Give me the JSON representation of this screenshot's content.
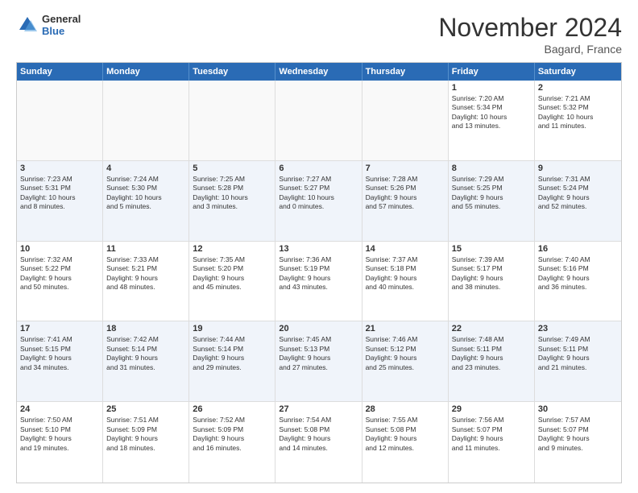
{
  "header": {
    "logo_general": "General",
    "logo_blue": "Blue",
    "month_title": "November 2024",
    "location": "Bagard, France"
  },
  "weekdays": [
    "Sunday",
    "Monday",
    "Tuesday",
    "Wednesday",
    "Thursday",
    "Friday",
    "Saturday"
  ],
  "weeks": [
    [
      {
        "day": "",
        "text": ""
      },
      {
        "day": "",
        "text": ""
      },
      {
        "day": "",
        "text": ""
      },
      {
        "day": "",
        "text": ""
      },
      {
        "day": "",
        "text": ""
      },
      {
        "day": "1",
        "text": "Sunrise: 7:20 AM\nSunset: 5:34 PM\nDaylight: 10 hours\nand 13 minutes."
      },
      {
        "day": "2",
        "text": "Sunrise: 7:21 AM\nSunset: 5:32 PM\nDaylight: 10 hours\nand 11 minutes."
      }
    ],
    [
      {
        "day": "3",
        "text": "Sunrise: 7:23 AM\nSunset: 5:31 PM\nDaylight: 10 hours\nand 8 minutes."
      },
      {
        "day": "4",
        "text": "Sunrise: 7:24 AM\nSunset: 5:30 PM\nDaylight: 10 hours\nand 5 minutes."
      },
      {
        "day": "5",
        "text": "Sunrise: 7:25 AM\nSunset: 5:28 PM\nDaylight: 10 hours\nand 3 minutes."
      },
      {
        "day": "6",
        "text": "Sunrise: 7:27 AM\nSunset: 5:27 PM\nDaylight: 10 hours\nand 0 minutes."
      },
      {
        "day": "7",
        "text": "Sunrise: 7:28 AM\nSunset: 5:26 PM\nDaylight: 9 hours\nand 57 minutes."
      },
      {
        "day": "8",
        "text": "Sunrise: 7:29 AM\nSunset: 5:25 PM\nDaylight: 9 hours\nand 55 minutes."
      },
      {
        "day": "9",
        "text": "Sunrise: 7:31 AM\nSunset: 5:24 PM\nDaylight: 9 hours\nand 52 minutes."
      }
    ],
    [
      {
        "day": "10",
        "text": "Sunrise: 7:32 AM\nSunset: 5:22 PM\nDaylight: 9 hours\nand 50 minutes."
      },
      {
        "day": "11",
        "text": "Sunrise: 7:33 AM\nSunset: 5:21 PM\nDaylight: 9 hours\nand 48 minutes."
      },
      {
        "day": "12",
        "text": "Sunrise: 7:35 AM\nSunset: 5:20 PM\nDaylight: 9 hours\nand 45 minutes."
      },
      {
        "day": "13",
        "text": "Sunrise: 7:36 AM\nSunset: 5:19 PM\nDaylight: 9 hours\nand 43 minutes."
      },
      {
        "day": "14",
        "text": "Sunrise: 7:37 AM\nSunset: 5:18 PM\nDaylight: 9 hours\nand 40 minutes."
      },
      {
        "day": "15",
        "text": "Sunrise: 7:39 AM\nSunset: 5:17 PM\nDaylight: 9 hours\nand 38 minutes."
      },
      {
        "day": "16",
        "text": "Sunrise: 7:40 AM\nSunset: 5:16 PM\nDaylight: 9 hours\nand 36 minutes."
      }
    ],
    [
      {
        "day": "17",
        "text": "Sunrise: 7:41 AM\nSunset: 5:15 PM\nDaylight: 9 hours\nand 34 minutes."
      },
      {
        "day": "18",
        "text": "Sunrise: 7:42 AM\nSunset: 5:14 PM\nDaylight: 9 hours\nand 31 minutes."
      },
      {
        "day": "19",
        "text": "Sunrise: 7:44 AM\nSunset: 5:14 PM\nDaylight: 9 hours\nand 29 minutes."
      },
      {
        "day": "20",
        "text": "Sunrise: 7:45 AM\nSunset: 5:13 PM\nDaylight: 9 hours\nand 27 minutes."
      },
      {
        "day": "21",
        "text": "Sunrise: 7:46 AM\nSunset: 5:12 PM\nDaylight: 9 hours\nand 25 minutes."
      },
      {
        "day": "22",
        "text": "Sunrise: 7:48 AM\nSunset: 5:11 PM\nDaylight: 9 hours\nand 23 minutes."
      },
      {
        "day": "23",
        "text": "Sunrise: 7:49 AM\nSunset: 5:11 PM\nDaylight: 9 hours\nand 21 minutes."
      }
    ],
    [
      {
        "day": "24",
        "text": "Sunrise: 7:50 AM\nSunset: 5:10 PM\nDaylight: 9 hours\nand 19 minutes."
      },
      {
        "day": "25",
        "text": "Sunrise: 7:51 AM\nSunset: 5:09 PM\nDaylight: 9 hours\nand 18 minutes."
      },
      {
        "day": "26",
        "text": "Sunrise: 7:52 AM\nSunset: 5:09 PM\nDaylight: 9 hours\nand 16 minutes."
      },
      {
        "day": "27",
        "text": "Sunrise: 7:54 AM\nSunset: 5:08 PM\nDaylight: 9 hours\nand 14 minutes."
      },
      {
        "day": "28",
        "text": "Sunrise: 7:55 AM\nSunset: 5:08 PM\nDaylight: 9 hours\nand 12 minutes."
      },
      {
        "day": "29",
        "text": "Sunrise: 7:56 AM\nSunset: 5:07 PM\nDaylight: 9 hours\nand 11 minutes."
      },
      {
        "day": "30",
        "text": "Sunrise: 7:57 AM\nSunset: 5:07 PM\nDaylight: 9 hours\nand 9 minutes."
      }
    ]
  ]
}
